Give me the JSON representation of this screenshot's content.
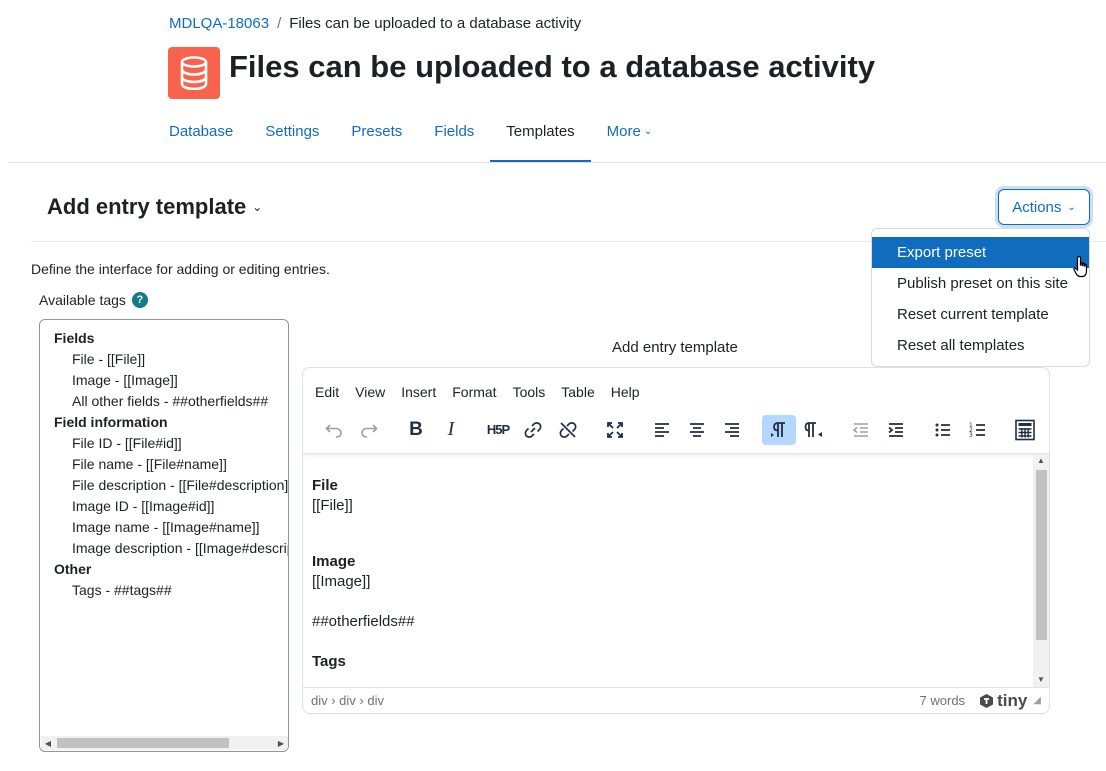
{
  "breadcrumb": {
    "course": "MDLQA-18063",
    "separator": "/",
    "current": "Files can be uploaded to a database activity"
  },
  "page_title": "Files can be uploaded to a database activity",
  "activity_icon": "database-icon",
  "tabs": [
    {
      "label": "Database"
    },
    {
      "label": "Settings"
    },
    {
      "label": "Presets"
    },
    {
      "label": "Fields"
    },
    {
      "label": "Templates"
    },
    {
      "label": "More"
    }
  ],
  "active_tab": "Templates",
  "section": {
    "title": "Add entry template",
    "actions_label": "Actions"
  },
  "actions_menu": [
    {
      "label": "Export preset"
    },
    {
      "label": "Publish preset on this site"
    },
    {
      "label": "Reset current template"
    },
    {
      "label": "Reset all templates"
    }
  ],
  "intro_text": "Define the interface for adding or editing entries.",
  "available_tags_label": "Available tags",
  "tags": {
    "fields_heading": "Fields",
    "fields": [
      "File - [[File]]",
      "Image - [[Image]]",
      "All other fields - ##otherfields##"
    ],
    "info_heading": "Field information",
    "info": [
      "File ID - [[File#id]]",
      "File name - [[File#name]]",
      "File description - [[File#description]]",
      "Image ID - [[Image#id]]",
      "Image name - [[Image#name]]",
      "Image description - [[Image#description]]"
    ],
    "other_heading": "Other",
    "other": [
      "Tags - ##tags##"
    ]
  },
  "editor": {
    "label": "Add entry template",
    "menu": [
      "Edit",
      "View",
      "Insert",
      "Format",
      "Tools",
      "Table",
      "Help"
    ],
    "content": {
      "file_heading": "File",
      "file_tag": "[[File]]",
      "image_heading": "Image",
      "image_tag": "[[Image]]",
      "other_tag": "##otherfields##",
      "tags_heading": "Tags"
    },
    "path": "div › div › div",
    "word_count": "7 words",
    "brand": "tiny"
  },
  "colors": {
    "accent": "#0f6cbf",
    "icon_bg": "#f7634d",
    "active_button": "#b4d7ff",
    "help": "#0f7c87"
  }
}
